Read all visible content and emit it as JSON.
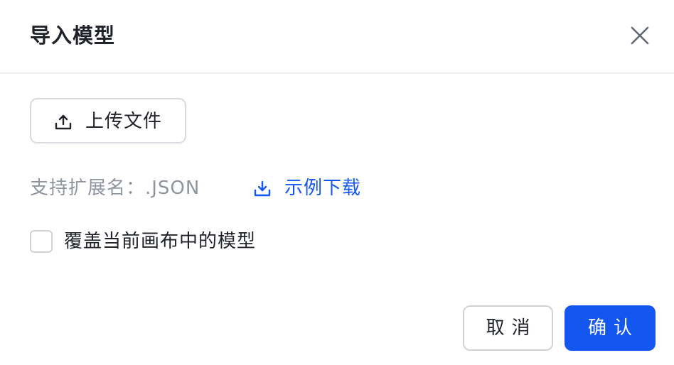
{
  "dialog": {
    "title": "导入模型"
  },
  "upload": {
    "label": "上传文件",
    "icon": "upload-icon"
  },
  "support": {
    "text": "支持扩展名：.JSON"
  },
  "example": {
    "label": "示例下载",
    "icon": "download-icon"
  },
  "overwrite": {
    "label": "覆盖当前画布中的模型",
    "checked": false
  },
  "footer": {
    "cancel_label": "取消",
    "confirm_label": "确认"
  },
  "colors": {
    "primary": "#1456f0",
    "text": "#1f2329",
    "muted": "#8f959e",
    "border": "#d0d3d6"
  }
}
